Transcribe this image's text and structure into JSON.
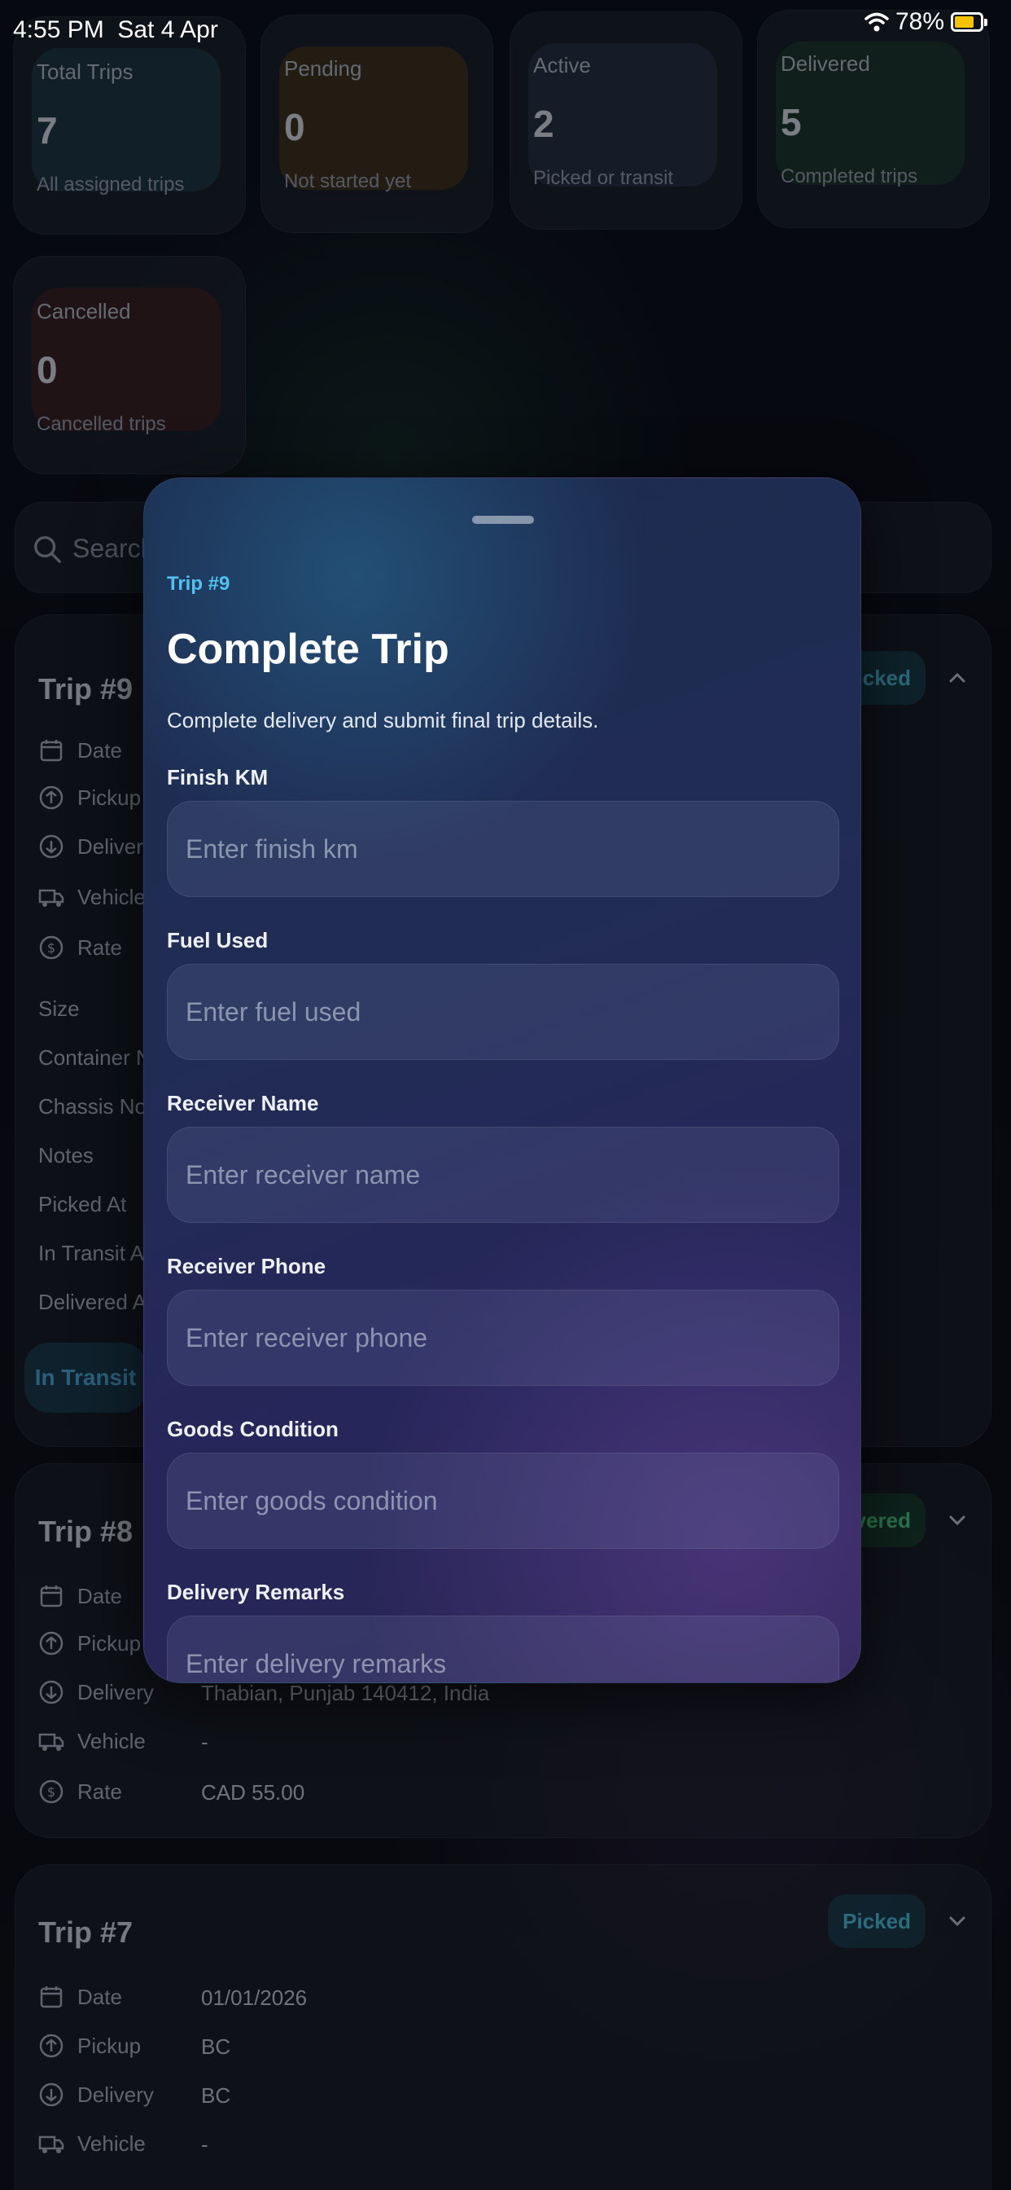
{
  "status_bar": {
    "time": "4:55 PM",
    "date": "Sat 4 Apr",
    "battery": "78%",
    "battery_level": 0.78
  },
  "stats": [
    {
      "label": "Total Trips",
      "value": "7",
      "sub": "All assigned trips",
      "tint": "#1f3a4a"
    },
    {
      "label": "Pending",
      "value": "0",
      "sub": "Not started yet",
      "tint": "#3e3424"
    },
    {
      "label": "Active",
      "value": "2",
      "sub": "Picked or transit",
      "tint": "#27334a"
    },
    {
      "label": "Delivered",
      "value": "5",
      "sub": "Completed trips",
      "tint": "#1f3a34"
    },
    {
      "label": "Cancelled",
      "value": "0",
      "sub": "Cancelled trips",
      "tint": "#3a2428"
    }
  ],
  "search": {
    "placeholder": "Search"
  },
  "trip9": {
    "title": "Trip #9",
    "badge": "Picked",
    "rows": [
      "Date",
      "Pickup",
      "Delivery",
      "Vehicle",
      "Rate"
    ],
    "extra_rows": [
      "Size",
      "Container No",
      "Chassis No",
      "Notes",
      "Picked At",
      "In Transit At",
      "Delivered At"
    ],
    "button": "In Transit"
  },
  "trip8": {
    "title": "Trip #8",
    "badge": "Delivered",
    "rows": [
      "Date",
      "Pickup",
      "Delivery",
      "Vehicle",
      "Rate"
    ],
    "values": {
      "delivery": "Thabian, Punjab 140412, India",
      "vehicle": "-",
      "rate": "CAD 55.00"
    }
  },
  "trip7": {
    "title": "Trip #7",
    "badge": "Picked",
    "rows": [
      "Date",
      "Pickup",
      "Delivery",
      "Vehicle"
    ],
    "values": {
      "date": "01/01/2026",
      "pickup": "BC",
      "delivery": "BC",
      "vehicle": "-"
    }
  },
  "modal": {
    "kicker": "Trip #9",
    "title": "Complete Trip",
    "subtitle": "Complete delivery and submit final trip details.",
    "fields": [
      {
        "label": "Finish KM",
        "placeholder": "Enter finish km"
      },
      {
        "label": "Fuel Used",
        "placeholder": "Enter fuel used"
      },
      {
        "label": "Receiver Name",
        "placeholder": "Enter receiver name"
      },
      {
        "label": "Receiver Phone",
        "placeholder": "Enter receiver phone"
      },
      {
        "label": "Goods Condition",
        "placeholder": "Enter goods condition"
      },
      {
        "label": "Delivery Remarks",
        "placeholder": "Enter delivery remarks"
      }
    ]
  }
}
